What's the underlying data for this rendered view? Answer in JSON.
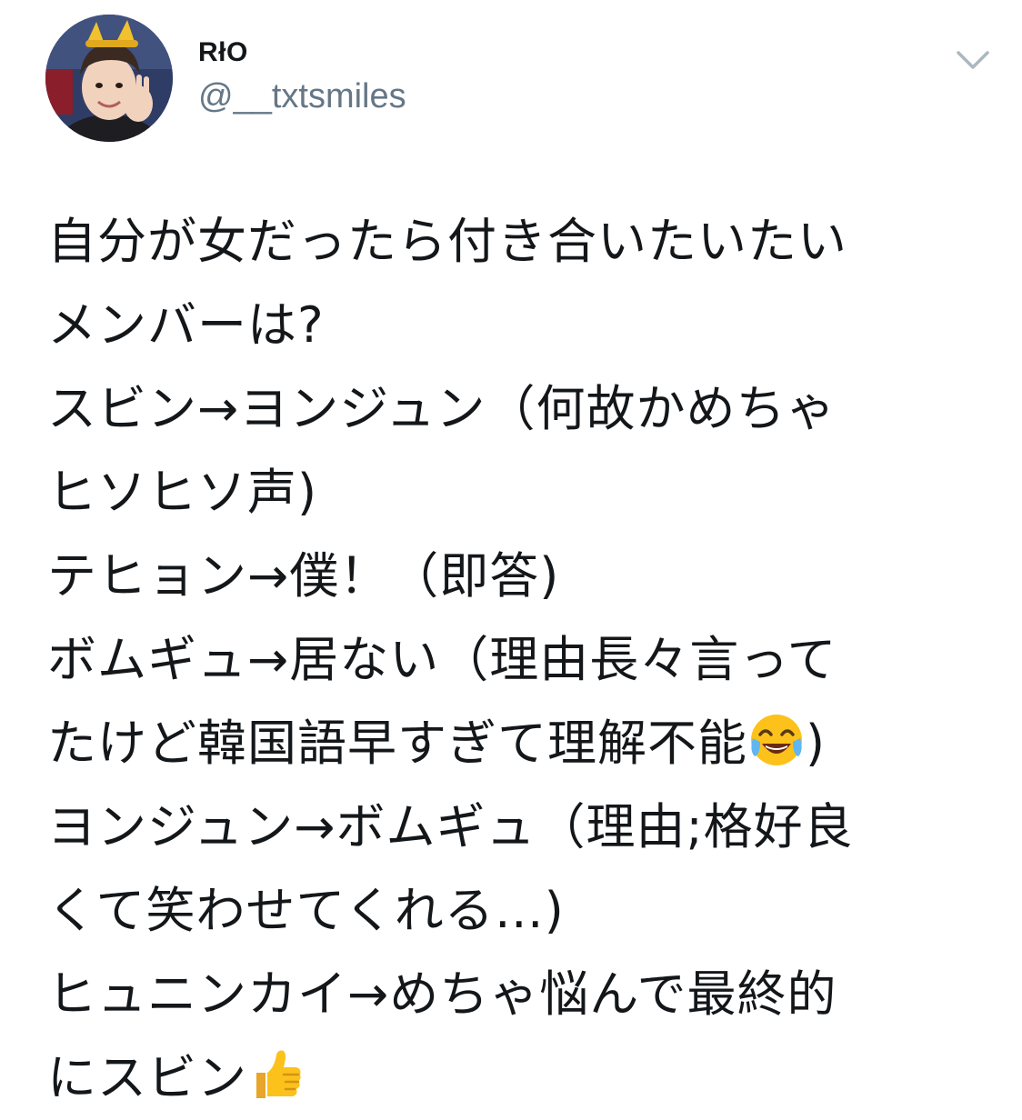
{
  "tweet": {
    "display_name": "RłO",
    "handle": "@__txtsmiles",
    "avatar_icon": "profile-photo-avatar",
    "menu_icon": "chevron-down-icon",
    "lines": [
      "自分が女だったら付き合いたいたい",
      "メンバーは?",
      "スビン→ヨンジュン（何故かめちゃ",
      "ヒソヒソ声)",
      "テヒョン→僕！（即答)",
      "ボムギュ→居ない（理由長々言って",
      "たけど韓国語早すぎて理解不能",
      "ヨンジュン→ボムギュ（理由;格好良",
      "くて笑わせてくれる…)",
      "ヒュニンカイ→めちゃ悩んで最終的",
      "にスビン"
    ],
    "line7_suffix": ")",
    "emoji": {
      "laughing": "face-with-tears-of-joy-icon",
      "thumbs": "thumbs-up-icon"
    },
    "colors": {
      "text": "#14171a",
      "secondary": "#657786",
      "background": "#ffffff"
    }
  }
}
